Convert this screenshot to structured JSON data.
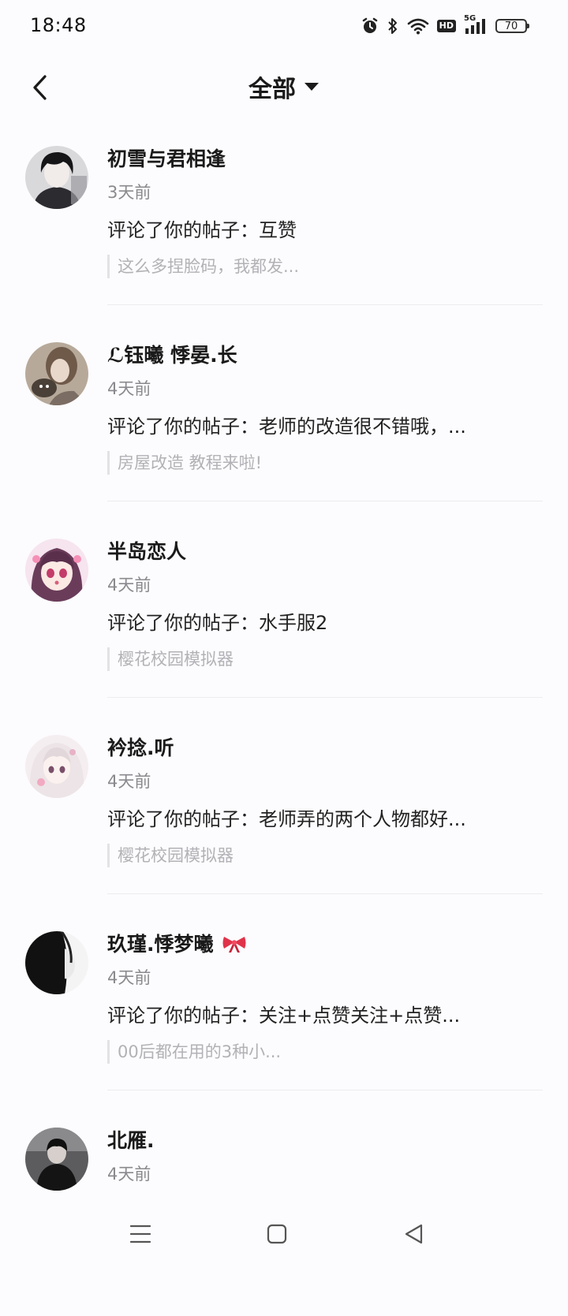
{
  "status": {
    "time": "18:48",
    "hd": "HD",
    "network": "5G",
    "battery": "70"
  },
  "header": {
    "title": "全部"
  },
  "items": [
    {
      "name": "初雪与君相逢",
      "time": "3天前",
      "comment": "评论了你的帖子：互赞",
      "quote": "这么多捏脸码，我都发...",
      "avatar_icon": "avatar-dark-hair-boy"
    },
    {
      "name": "ℒ钰曦 悸晏.长",
      "time": "4天前",
      "comment": "评论了你的帖子：老师的改造很不错哦，...",
      "quote": "房屋改造 教程来啦!",
      "avatar_icon": "avatar-girl-with-pet"
    },
    {
      "name": "半岛恋人",
      "time": "4天前",
      "comment": "评论了你的帖子：水手服2",
      "quote": "樱花校园模拟器",
      "avatar_icon": "avatar-anime-girl-pink"
    },
    {
      "name": "衿捻.听",
      "time": "4天前",
      "comment": "评论了你的帖子：老师弄的两个人物都好...",
      "quote": "樱花校园模拟器",
      "avatar_icon": "avatar-anime-girl-white"
    },
    {
      "name": "玖瑾.悸梦曦",
      "time": "4天前",
      "comment": "评论了你的帖子：关注+点赞关注+点赞...",
      "quote": "00后都在用的3种小...",
      "avatar_icon": "avatar-bw-girl-profile"
    },
    {
      "name": "北雁.",
      "time": "4天前",
      "comment": "",
      "quote": "",
      "avatar_icon": "avatar-man-dark-coat"
    }
  ],
  "colors": {
    "background": "#fcfbfd",
    "text_primary": "#1a1a1a",
    "text_secondary": "#8a8a8e",
    "text_quote": "#b2b2b6",
    "divider": "#ececee",
    "bow": "#e0334a"
  }
}
